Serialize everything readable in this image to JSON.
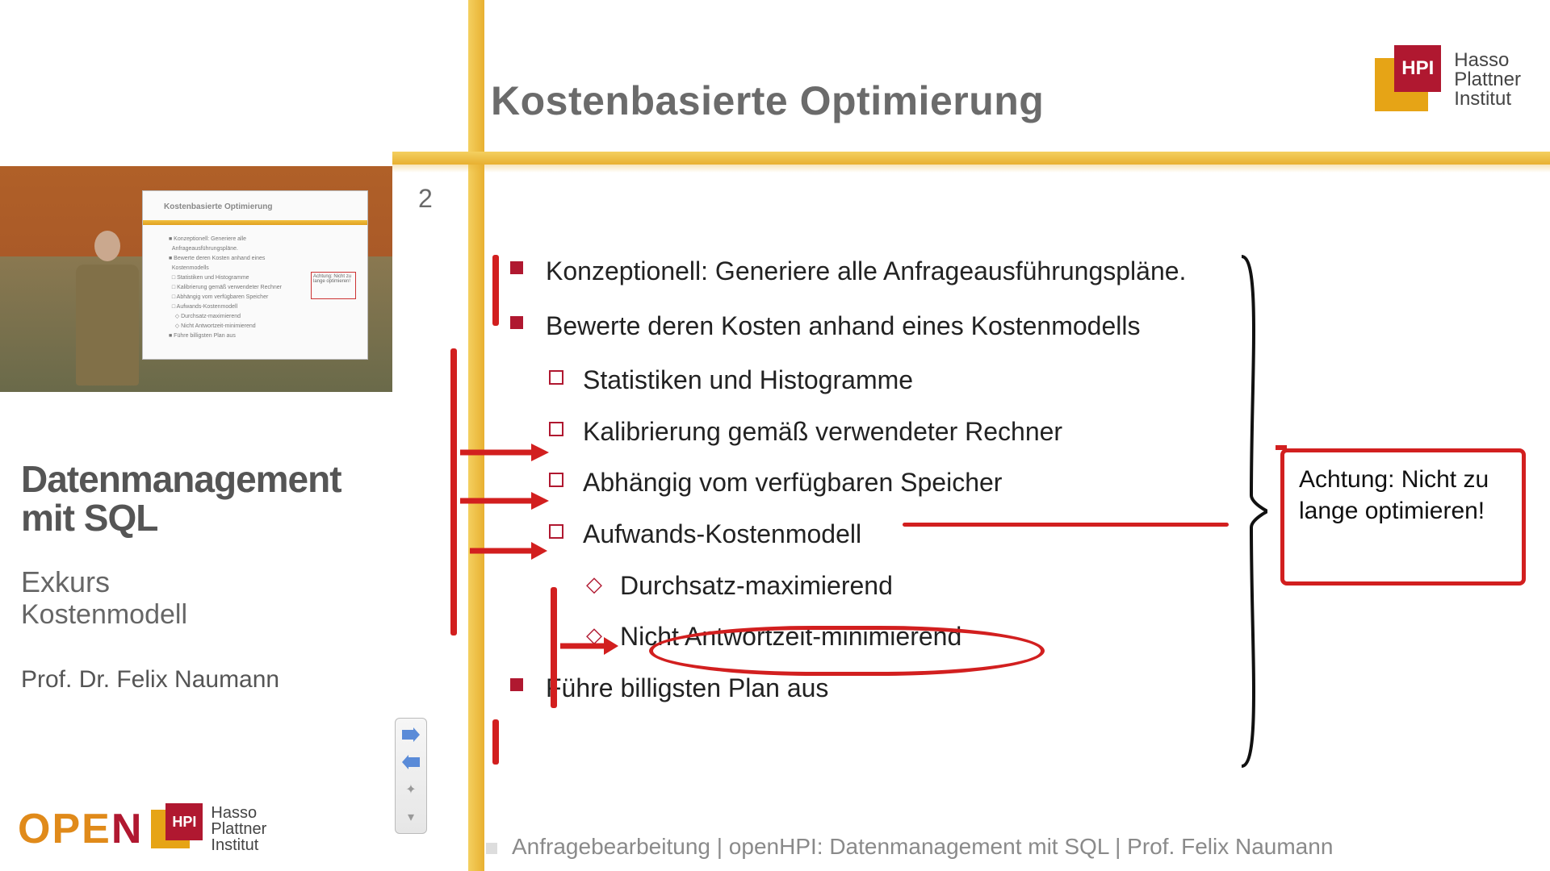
{
  "left": {
    "course_title": "Datenmanagement mit SQL",
    "sub1": "Exkurs",
    "sub2": "Kostenmodell",
    "author": "Prof. Dr. Felix Naumann",
    "open": {
      "o": "O",
      "p": "P",
      "e": "E",
      "n": "N"
    },
    "hpi_abbr": "HPI",
    "hpi_full": "Hasso\nPlattner\nInstitut",
    "mini_title": "Kostenbasierte Optimierung"
  },
  "slide": {
    "title": "Kostenbasierte Optimierung",
    "page_num": "2",
    "bullets": {
      "b1": "Konzeptionell: Generiere alle Anfrageausführungspläne.",
      "b2": "Bewerte deren Kosten anhand eines Kostenmodells",
      "b2a": "Statistiken und Histogramme",
      "b2b": "Kalibrierung gemäß verwendeter Rechner",
      "b2c": "Abhängig vom verfügbaren Speicher",
      "b2d": "Aufwands-Kostenmodell",
      "b2d1": "Durchsatz-maximierend",
      "b2d2": "Nicht Antwortzeit-minimierend",
      "b3": "Führe billigsten Plan aus"
    },
    "warning": "Achtung: Nicht zu lange optimieren!",
    "footer": "Anfragebearbeitung | openHPI: Datenmanagement mit SQL | Prof. Felix Naumann",
    "hpi_abbr": "HPI",
    "hpi_full": "Hasso\nPlattner\nInstitut"
  },
  "toolbar": {
    "next": "→",
    "prev": "←",
    "zoom": "⤧",
    "more": "▾"
  }
}
